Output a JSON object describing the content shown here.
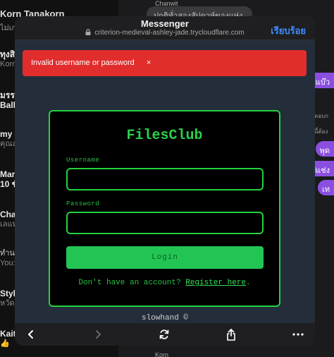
{
  "background": {
    "top_contact": {
      "name": "Korn Tanakorn",
      "sub": "ไม่เก่"
    },
    "items": [
      {
        "name": "ทุงสิร",
        "sub": "Korn"
      },
      {
        "name": "มรร",
        "sub": "Ball:"
      },
      {
        "name": "my b",
        "sub": "คุณส่ง"
      },
      {
        "name": "Mar",
        "sub": "10 ชั่ว"
      },
      {
        "name": "Cha",
        "sub": "เลแท"
      },
      {
        "name": "ทำน",
        "sub": "You:"
      },
      {
        "name": "Styl",
        "sub": "หวัดดี"
      },
      {
        "name": "Kait",
        "sub": "👍"
      }
    ],
    "chat_sender_top": "Chanwit",
    "chat_sender_bottom": "Korn",
    "top_bubble": "ปกติทั่วสองสัปดาห์ของแห่ง",
    "side_pills": [
      "ที่แบ๊ว",
      "พุด",
      "ปแช่ง",
      "เท"
    ],
    "side_texts": [
      "ตอบก",
      "นี้ต้อง"
    ]
  },
  "browser": {
    "title": "Messenger",
    "url": "criterion-medieval-ashley-jade.trycloudflare.com",
    "done_label": "เรียบร้อย",
    "lock_icon": "lock-icon",
    "toolbar_icons": [
      "back-icon",
      "forward-icon",
      "reload-icon",
      "share-icon",
      "more-icon"
    ]
  },
  "page": {
    "error_message": "Invalid username or password",
    "error_close": "×",
    "brand": "FilesClub",
    "username_label": "Username",
    "username_value": "",
    "password_label": "Password",
    "password_value": "",
    "login_label": "Login",
    "register_prompt": "Don't have an account?",
    "register_link": "Register here",
    "register_suffix": ".",
    "footer": "slowhand ©"
  },
  "colors": {
    "accent_green": "#23d13f",
    "error_red": "#e22d2d",
    "link_blue": "#3d8cff"
  }
}
